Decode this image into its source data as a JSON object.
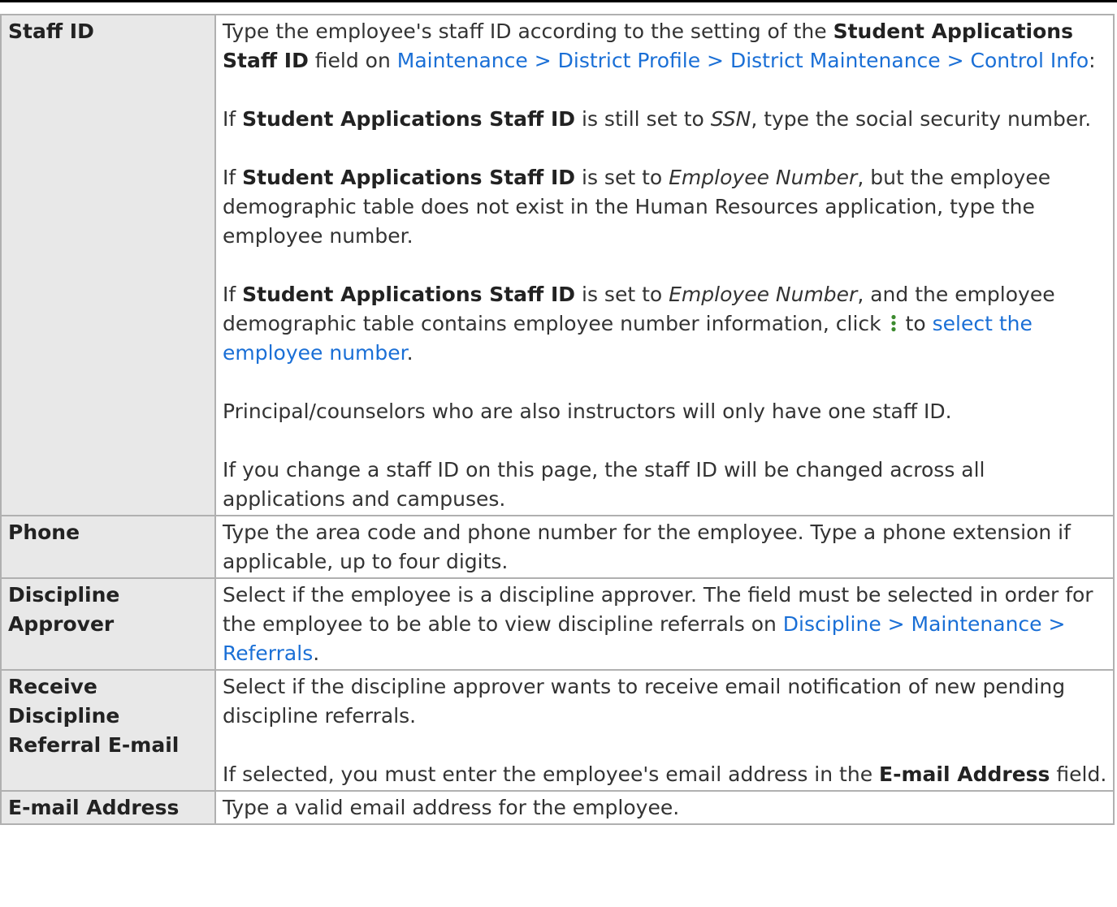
{
  "rows": [
    {
      "label": "Staff ID",
      "p1": {
        "t1": "Type the employee's staff ID according to the setting of the ",
        "b1": "Student Applications Staff ID",
        "t2": " field on ",
        "link": "Maintenance > District Profile > District Maintenance > Control Info",
        "t3": ":"
      },
      "p2": {
        "t1": "If ",
        "b1": "Student Applications Staff ID",
        "t2": " is still set to ",
        "i1": "SSN",
        "t3": ", type the social security number."
      },
      "p3": {
        "t1": "If ",
        "b1": "Student Applications Staff ID",
        "t2": " is set to ",
        "i1": "Employee Number",
        "t3": ", but the employee demographic table does not exist in the Human Resources application, type the employee number."
      },
      "p4": {
        "t1": "If ",
        "b1": "Student Applications Staff ID",
        "t2": " is set to ",
        "i1": "Employee Number",
        "t3": ", and the employee demographic table contains employee number information, click ",
        "t4": " to ",
        "link": "select the employee number",
        "t5": "."
      },
      "p5": "Principal/counselors who are also instructors will only have one staff ID.",
      "p6": "If you change a staff ID on this page, the staff ID will be changed across all applications and campuses."
    },
    {
      "label": "Phone",
      "p1": "Type the area code and phone number for the employee. Type a phone extension if applicable, up to four digits."
    },
    {
      "label": "Discipline Approver",
      "p1": {
        "t1": "Select if the employee is a discipline approver. The field must be selected in order for the employee to be able to view discipline referrals on ",
        "link": "Discipline > Maintenance > Referrals",
        "t2": "."
      }
    },
    {
      "label": "Receive Discipline Referral E-mail",
      "p1": "Select if the discipline approver wants to receive email notification of new pending discipline referrals.",
      "p2": {
        "t1": "If selected, you must enter the employee's email address in the ",
        "b1": "E-mail Address",
        "t2": " field."
      }
    },
    {
      "label": "E-mail Address",
      "p1": "Type a valid email address for the employee."
    }
  ],
  "icons": {
    "kebab": "vertical-ellipsis-icon"
  },
  "colors": {
    "link": "#1a6fd6",
    "label_background": "#e8e8e8",
    "border": "#b0b0b0",
    "text": "#333333"
  }
}
